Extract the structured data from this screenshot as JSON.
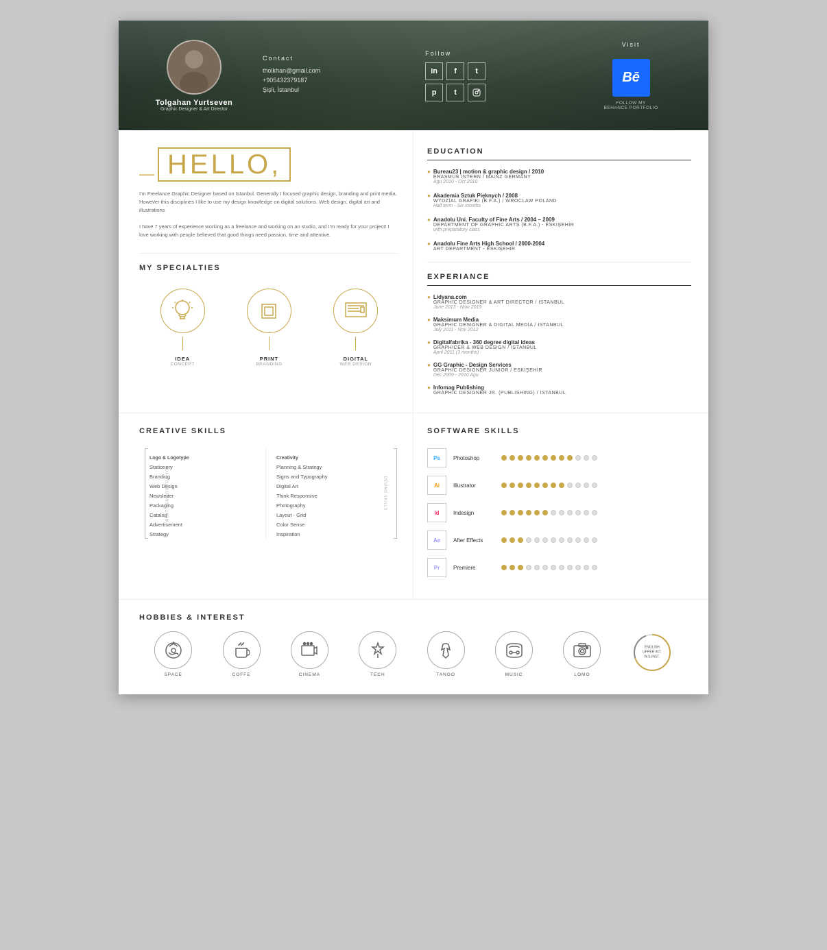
{
  "header": {
    "name": "Tolgahan Yurtseven",
    "subtitle": "Graphic Designer & Art Director",
    "contact": {
      "title": "Contact",
      "email": "tholkhan@gmail.com",
      "phone": "+905432379187",
      "location": "Şişli, İstanbul"
    },
    "follow": {
      "title": "Follow",
      "icons": [
        "in",
        "f",
        "t",
        "p",
        "t2",
        "cam"
      ]
    },
    "visit": {
      "title": "Visit",
      "behance_label": "FOLLOW MY\nBEHANCE PORTFOLIO"
    }
  },
  "hello": {
    "greeting": "HELLO,",
    "bio1": "I'm Freelance Graphic Designer based on Istanbul. Generally I focused graphic design, branding and print media. However this disciplines I like to use my design knowledge on digital solutions. Web design, digital art and illustrations",
    "bio2": "I have 7 years of experience working as a freelance and working on an studio, and I'm ready for your project! I love working with people believed that good things need passion, time and attentive."
  },
  "education": {
    "title": "EDUCATION",
    "items": [
      {
        "name": "Bureau23 | motion & graphic design / 2010",
        "sub1": "ERASMUS INTERN / MAINZ GERMANY",
        "date": "Agu 2010 - Oct 2010"
      },
      {
        "name": "Akademia Sztuk Pięknych / 2008",
        "sub1": "WYDZIAL GRAFIKI (B.F.A.) / WROCLAW POLAND",
        "date": "Half term - Six months"
      },
      {
        "name": "Anadolu Uni. Faculty of Fine Arts / 2004 – 2009",
        "sub1": "DEPARTMENT OF GRAPHIC ARTS (B.F.A.) - ESKİŞEHİR",
        "date": "with preparatory class"
      },
      {
        "name": "Anadolu Fine Arts High School / 2000-2004",
        "sub1": "ART DEPARTMENT - ESKİŞEHİR",
        "date": ""
      }
    ]
  },
  "specialties": {
    "title": "MY SPECIALTIES",
    "items": [
      {
        "label": "IDEA",
        "sublabel": "CONCEPT",
        "icon": "💡"
      },
      {
        "label": "PRINT",
        "sublabel": "BRANDING",
        "icon": "▢"
      },
      {
        "label": "DIGITAL",
        "sublabel": "WEB DESIGN",
        "icon": "🖥"
      }
    ]
  },
  "experience": {
    "title": "EXPERIANCE",
    "items": [
      {
        "company": "Lidyana.com",
        "role": "GRAPHIC DESIGNER & ART DIRECTOR / ISTANBUL",
        "date": "June 2013 - Now 2015"
      },
      {
        "company": "Maksimum Media",
        "role": "GRAPHIC DESIGNER & DIGITAL MEDIA / ISTANBUL",
        "date": "July 2011 - Nov 2012"
      },
      {
        "company": "Digitalfabrika - 360 degree digital ideas",
        "role": "GRAPHICER & WEB DESIGN / ISTANBUL",
        "date": "April 2011 (3 months)"
      },
      {
        "company": "GG Graphic - Design Services",
        "role": "GRAPHIC DESIGNER JUNIOR / ESKİŞEHİR",
        "date": "Dec 2009 - 2010 Agu"
      },
      {
        "company": "Infomag Publishing",
        "role": "GRAPHIC DESIGNER JR. (PUBLISHING) / ISTANBUL",
        "date": ""
      }
    ]
  },
  "creative_skills": {
    "title": "CREATIVE SKILLS",
    "what_i_do": "WHAT I CAN DO FOR YOU",
    "design_skills": "DESING SKILLS",
    "left_items": [
      "Logo & Logotype",
      "Stationery",
      "Branding",
      "Web Design",
      "Newsletter",
      "Packaging",
      "Catalog",
      "Advertisement",
      "Strategy"
    ],
    "right_items": [
      "Creativity",
      "Planning & Strategy",
      "Signs and Typography",
      "Digital Art",
      "Think Responsive",
      "Photography",
      "Layout - Grid",
      "Color Sense",
      "Inspiration"
    ]
  },
  "software_skills": {
    "title": "SOFTWARE SKILLS",
    "items": [
      {
        "name": "Photoshop",
        "icon": "Ps",
        "filled": 9,
        "empty": 3
      },
      {
        "name": "Illustrator",
        "icon": "Ai",
        "filled": 8,
        "empty": 4
      },
      {
        "name": "Indesign",
        "icon": "Id",
        "filled": 6,
        "empty": 6
      },
      {
        "name": "After Effects",
        "icon": "Ae",
        "filled": 3,
        "empty": 9
      },
      {
        "name": "Premiere",
        "icon": "Pr",
        "filled": 3,
        "empty": 9
      }
    ]
  },
  "hobbies": {
    "title": "HOBBIES & INTEREST",
    "items": [
      {
        "label": "SPACE",
        "icon": "🔭"
      },
      {
        "label": "COFFE",
        "icon": "☕"
      },
      {
        "label": "CINEMA",
        "icon": "🎬"
      },
      {
        "label": "TECH",
        "icon": "🚀"
      },
      {
        "label": "TANGO",
        "icon": "👠"
      },
      {
        "label": "MUSIC",
        "icon": "🎧"
      },
      {
        "label": "LOMO",
        "icon": "📷"
      }
    ],
    "language": {
      "level": "ENGLISH\nUPPER INT.\nW.S.INST."
    }
  }
}
